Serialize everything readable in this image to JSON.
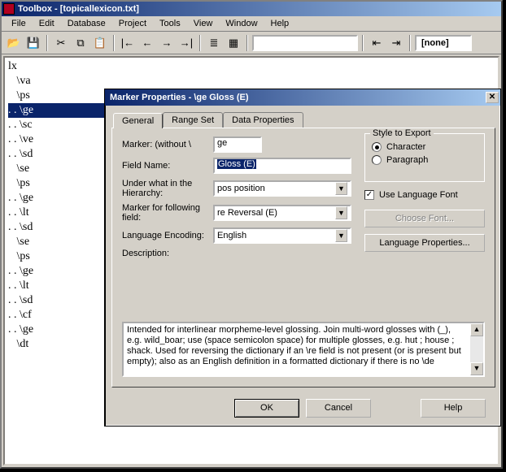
{
  "app": {
    "title": "Toolbox - [topicallexicon.txt]",
    "status_combo_value": "[none]"
  },
  "menu": [
    "File",
    "Edit",
    "Database",
    "Project",
    "Tools",
    "View",
    "Window",
    "Help"
  ],
  "toolbar_icons": {
    "open": "📂",
    "save": "💾",
    "cut": "✂",
    "copy": "⧉",
    "paste": "📋",
    "first": "|←",
    "prev": "←",
    "next": "→",
    "last": "→|",
    "list": "≣",
    "grid": "▦",
    "findprev": "⇤",
    "findnext": "⇥"
  },
  "tree": [
    {
      "t": "lx",
      "d": 0,
      "sel": false
    },
    {
      "t": "\\va",
      "d": 1,
      "sel": false
    },
    {
      "t": "\\ps",
      "d": 1,
      "sel": false
    },
    {
      "t": ". . \\ge",
      "d": 0,
      "sel": true
    },
    {
      "t": ". . \\sc",
      "d": 0,
      "sel": false
    },
    {
      "t": ". . \\ve",
      "d": 0,
      "sel": false
    },
    {
      "t": ". . \\sd",
      "d": 0,
      "sel": false
    },
    {
      "t": "\\se",
      "d": 1,
      "sel": false
    },
    {
      "t": "\\ps",
      "d": 1,
      "sel": false
    },
    {
      "t": ". . \\ge",
      "d": 0,
      "sel": false
    },
    {
      "t": ". . \\lt",
      "d": 0,
      "sel": false
    },
    {
      "t": ". . \\sd",
      "d": 0,
      "sel": false
    },
    {
      "t": "\\se",
      "d": 1,
      "sel": false
    },
    {
      "t": "\\ps",
      "d": 1,
      "sel": false
    },
    {
      "t": ". . \\ge",
      "d": 0,
      "sel": false
    },
    {
      "t": ". . \\lt",
      "d": 0,
      "sel": false
    },
    {
      "t": ". . \\sd",
      "d": 0,
      "sel": false
    },
    {
      "t": ". . \\cf",
      "d": 0,
      "sel": false
    },
    {
      "t": ". . \\ge",
      "d": 0,
      "sel": false
    },
    {
      "t": "\\dt",
      "d": 1,
      "sel": false
    }
  ],
  "dialog": {
    "title": "Marker Properties - \\ge Gloss (E)",
    "tabs": [
      "General",
      "Range Set",
      "Data Properties"
    ],
    "active_tab": 0,
    "labels": {
      "marker": "Marker: (without \\",
      "field_name": "Field Name:",
      "under": "Under what in the Hierarchy:",
      "following": "Marker for following field:",
      "lang": "Language Encoding:",
      "desc": "Description:",
      "style_group": "Style to Export",
      "radio_char": "Character",
      "radio_para": "Paragraph",
      "use_lang_font": "Use Language Font",
      "choose_font": "Choose Font...",
      "lang_props": "Language Properties..."
    },
    "values": {
      "marker": "ge",
      "field_name": "Gloss (E)",
      "under": "pos  position",
      "following": "re  Reversal (E)",
      "lang": "English",
      "style_radio": "Character",
      "use_lang_font_checked": true
    },
    "description": "Intended for interlinear morpheme-level glossing. Join multi-word glosses with (_), e.g. wild_boar; use (space semicolon space) for multiple glosses, e.g. hut ; house ; shack. Used for reversing the dictionary if an \\re field is not present (or is present but empty); also as an English definition in a formatted dictionary if there is no \\de",
    "buttons": {
      "ok": "OK",
      "cancel": "Cancel",
      "help": "Help"
    }
  }
}
